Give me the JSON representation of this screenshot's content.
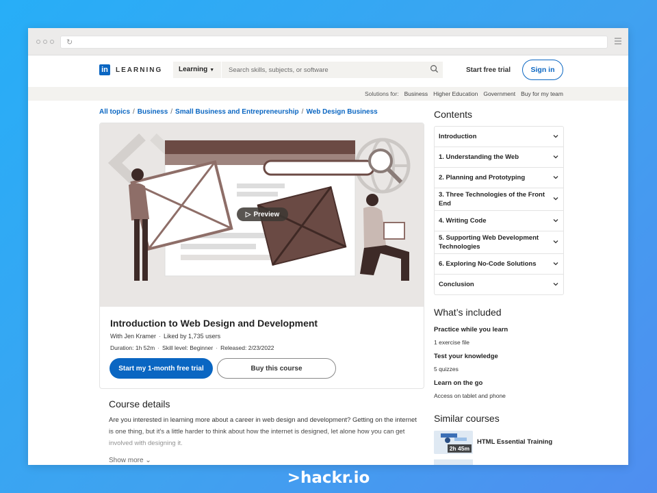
{
  "header": {
    "logo_mark": "in",
    "logo_text": "LEARNING",
    "learning_dropdown": "Learning",
    "search_placeholder": "Search skills, subjects, or software",
    "start_free_trial": "Start free trial",
    "sign_in": "Sign in"
  },
  "solutions_bar": {
    "label": "Solutions for:",
    "items": [
      "Business",
      "Higher Education",
      "Government",
      "Buy for my team"
    ]
  },
  "breadcrumb": [
    "All topics",
    "Business",
    "Small Business and Entrepreneurship",
    "Web Design Business"
  ],
  "course": {
    "preview": "Preview",
    "title": "Introduction to Web Design and Development",
    "author": "With Jen Kramer",
    "likes": "Liked by 1,735 users",
    "duration": "Duration: 1h 52m",
    "skill_level": "Skill level: Beginner",
    "released": "Released: 2/23/2022",
    "trial_button": "Start my 1-month free trial",
    "buy_button": "Buy this course"
  },
  "details": {
    "title": "Course details",
    "text": "Are you interested in learning more about a career in web design and development? Getting on the internet is one thing, but it’s a little harder to think about how the internet is designed, let alone how you can get involved with designing it.",
    "show_more": "Show more"
  },
  "contents": {
    "title": "Contents",
    "items": [
      "Introduction",
      "1. Understanding the Web",
      "2. Planning and Prototyping",
      "3. Three Technologies of the Front End",
      "4. Writing Code",
      "5. Supporting Web Development Technologies",
      "6. Exploring No-Code Solutions",
      "Conclusion"
    ]
  },
  "included": {
    "title": "What’s included",
    "items": [
      {
        "heading": "Practice while you learn",
        "sub": "1 exercise file"
      },
      {
        "heading": "Test your knowledge",
        "sub": "5 quizzes"
      },
      {
        "heading": "Learn on the go",
        "sub": "Access on tablet and phone"
      }
    ]
  },
  "similar": {
    "title": "Similar courses",
    "items": [
      {
        "name": "HTML Essential Training",
        "duration": "2h 45m"
      }
    ]
  },
  "watermark": {
    "prefix": ">",
    "brand": "hackr.io"
  },
  "colors": {
    "accent": "#0a66c2",
    "background_gradient_start": "#27aef7",
    "background_gradient_end": "#4f8ef0"
  }
}
